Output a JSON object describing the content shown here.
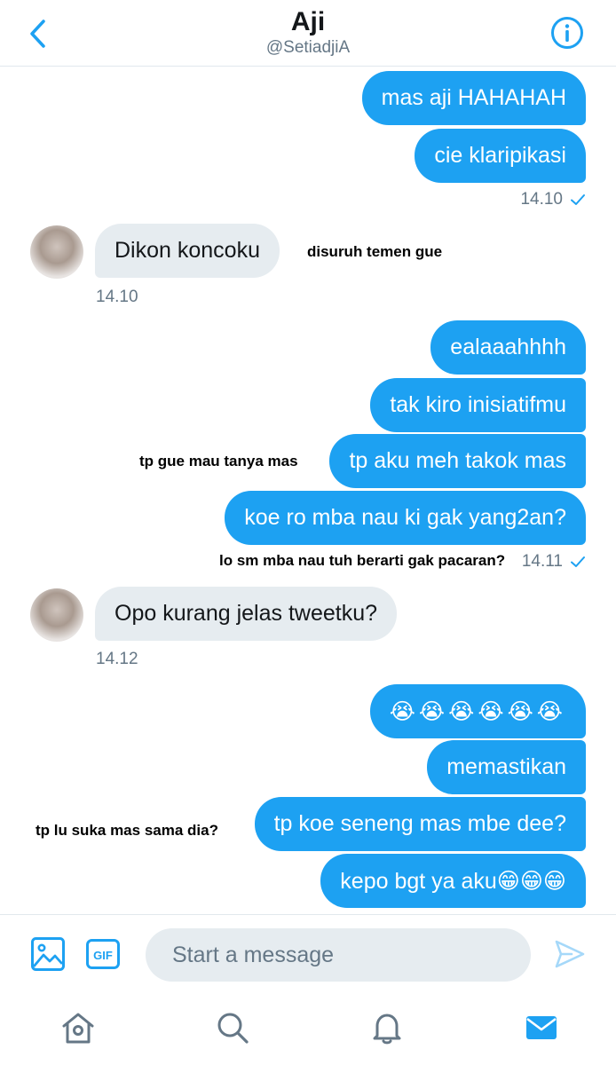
{
  "header": {
    "title": "Aji",
    "handle": "@SetiadjiA"
  },
  "messages": [
    {
      "text": "mas aji HAHAHAH"
    },
    {
      "text": "cie klaripikasi"
    },
    {
      "text": "Dikon koncoku"
    },
    {
      "text": "ealaaahhhh"
    },
    {
      "text": "tak kiro inisiatifmu"
    },
    {
      "text": "tp aku meh takok mas"
    },
    {
      "text": "koe ro mba nau ki gak yang2an?"
    },
    {
      "text": "Opo kurang jelas tweetku?"
    },
    {
      "text": "😭😭😭😭😭😭"
    },
    {
      "text": "memastikan"
    },
    {
      "text": "tp koe seneng mas mbe dee?"
    },
    {
      "text": "kepo bgt ya aku😁😁😁"
    }
  ],
  "timestamps": [
    "14.10",
    "14.10",
    "14.11",
    "14.12"
  ],
  "annotations": [
    "disuruh temen gue",
    "tp gue mau tanya mas",
    "lo sm mba nau tuh berarti gak pacaran?",
    "tp lu suka mas sama dia?"
  ],
  "composer": {
    "placeholder": "Start a message",
    "gif_label": "GIF"
  },
  "colors": {
    "accent": "#1da1f2",
    "incoming_bubble": "#e6ecf0",
    "muted_text": "#657786"
  },
  "icons": {
    "back": "back-chevron-icon",
    "info": "info-icon",
    "image": "image-icon",
    "gif": "gif-icon",
    "send": "send-icon",
    "home": "home-icon",
    "search": "search-icon",
    "notifications": "bell-icon",
    "messages": "mail-icon"
  }
}
